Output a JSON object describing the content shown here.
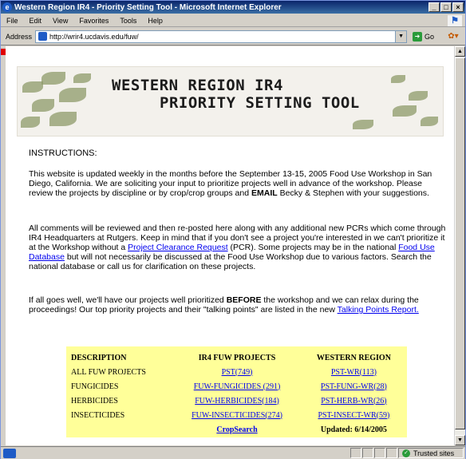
{
  "window": {
    "title": "Western Region IR4 - Priority Setting Tool - Microsoft Internet Explorer",
    "minimize": "_",
    "maximize": "□",
    "close": "×"
  },
  "menu": {
    "items": [
      "File",
      "Edit",
      "View",
      "Favorites",
      "Tools",
      "Help"
    ]
  },
  "address": {
    "label": "Address",
    "url": "http://wrir4.ucdavis.edu/fuw/",
    "go_label": "Go"
  },
  "banner": {
    "line1": "WESTERN REGION IR4",
    "line2": "PRIORITY SETTING TOOL"
  },
  "content": {
    "instructions_heading": "INSTRUCTIONS:",
    "p1_a": "This website is updated weekly in the months before the September 13-15, 2005 Food Use Workshop in San Diego, California. We are soliciting your input to prioritize projects well in advance of the workshop. Please review the projects by discipline or by crop/crop groups and ",
    "p1_bold": "EMAIL",
    "p1_b": " Becky & Stephen with your suggestions.",
    "p2_a": "All comments will be reviewed and then re-posted here along with any additional new PCRs which come through IR4 Headquarters at Rutgers. Keep in mind that if you don't see a project you're interested in we can't prioritize it at the Workshop without a ",
    "p2_link1": "Project Clearance Request",
    "p2_b": " (PCR). Some projects may be in the national ",
    "p2_link2": "Food Use Database",
    "p2_c": " but will not necessarily be discussed at the Food Use Workshop due to various factors. Search the national database or call us for clarification on these projects.",
    "p3_a": "If all goes well, we'll have our projects well prioritized ",
    "p3_bold": "BEFORE",
    "p3_b": " the workshop and we can relax during the proceedings! Our top priority projects and their \"talking points\" are listed in the new ",
    "p3_link": "Talking Points Report."
  },
  "projects": {
    "headers": [
      "DESCRIPTION",
      "IR4 FUW PROJECTS",
      "WESTERN REGION"
    ],
    "rows": [
      {
        "desc": "ALL FUW PROJECTS",
        "fuw": "PST(749)",
        "wr": "PST-WR(113)"
      },
      {
        "desc": "FUNGICIDES",
        "fuw": "FUW-FUNGICIDES (291)",
        "wr": "PST-FUNG-WR(28)"
      },
      {
        "desc": "HERBICIDES",
        "fuw": "FUW-HERBICIDES(184)",
        "wr": "PST-HERB-WR(26)"
      },
      {
        "desc": "INSECTICIDES",
        "fuw": "FUW-INSECTICIDES(274)",
        "wr": "PST-INSECT-WR(59)"
      }
    ],
    "crop_search": "CropSearch",
    "updated": "Updated: 6/14/2005"
  },
  "status": {
    "zone": "Trusted sites"
  }
}
